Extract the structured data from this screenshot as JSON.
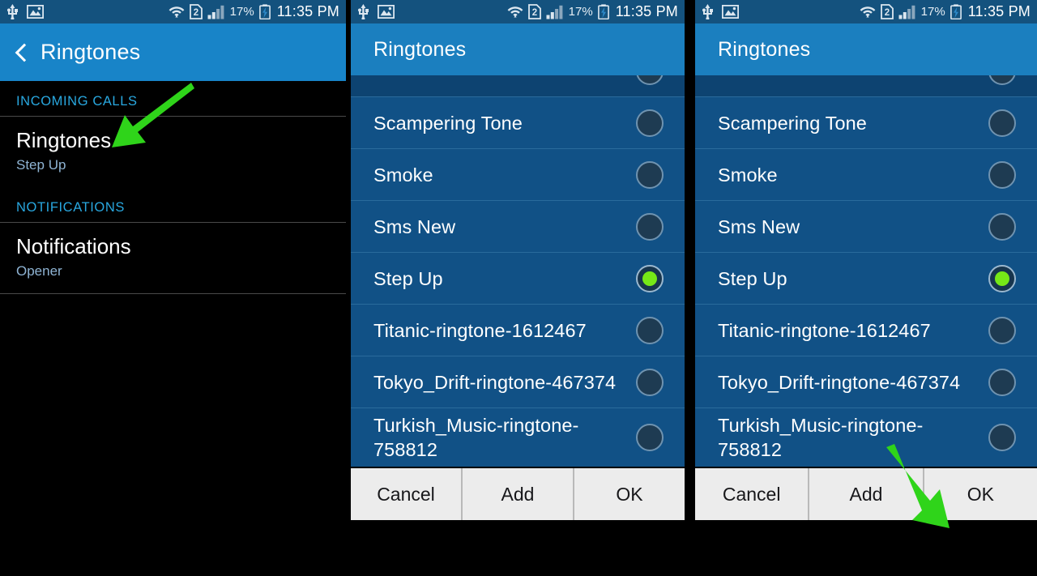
{
  "status_bar": {
    "icons_left": [
      "usb-icon",
      "screenshot-image-icon"
    ],
    "icons_right": [
      "wifi-icon",
      "sim2-icon",
      "signal-bars-icon",
      "battery-charging-icon"
    ],
    "battery_percent": "17%",
    "clock": "11:35 PM"
  },
  "left_panel": {
    "action_bar": {
      "back_icon": "back-chevron-icon",
      "title": "Ringtones"
    },
    "sections": [
      {
        "header": "INCOMING CALLS",
        "rows": [
          {
            "title": "Ringtones",
            "subtitle": "Step Up"
          }
        ]
      },
      {
        "header": "NOTIFICATIONS",
        "rows": [
          {
            "title": "Notifications",
            "subtitle": "Opener"
          }
        ]
      }
    ]
  },
  "dialog": {
    "title": "Ringtones",
    "rows": [
      {
        "label": "",
        "selected": false,
        "partial": true
      },
      {
        "label": "Scampering Tone",
        "selected": false,
        "partial": false
      },
      {
        "label": "Smoke",
        "selected": false,
        "partial": false
      },
      {
        "label": "Sms New",
        "selected": false,
        "partial": false
      },
      {
        "label": "Step Up",
        "selected": true,
        "partial": false
      },
      {
        "label": "Titanic-ringtone-1612467",
        "selected": false,
        "partial": false
      },
      {
        "label": "Tokyo_Drift-ringtone-467374",
        "selected": false,
        "partial": false
      },
      {
        "label": "Turkish_Music-ringtone-758812",
        "selected": false,
        "partial": false
      }
    ],
    "buttons": [
      {
        "label": "Cancel"
      },
      {
        "label": "Add"
      },
      {
        "label": "OK"
      }
    ]
  },
  "annotations": {
    "arrow_color": "#2fd41a",
    "arrows": [
      {
        "name": "arrow-to-ringtones-setting",
        "target": "Ringtones"
      },
      {
        "name": "arrow-to-step-up-row",
        "target": "Step Up"
      },
      {
        "name": "arrow-to-ok-button",
        "target": "OK"
      }
    ]
  },
  "colors": {
    "status_bar_bg": "#14527e",
    "action_bar_bg": "#1884c8",
    "dialog_header_bg": "#1b7fbf",
    "row_bg": "#115186",
    "selected_dot": "#76e817",
    "button_bg": "#ececec",
    "section_header_text": "#29a8e0",
    "subtitle_text": "#8fb4d4"
  }
}
